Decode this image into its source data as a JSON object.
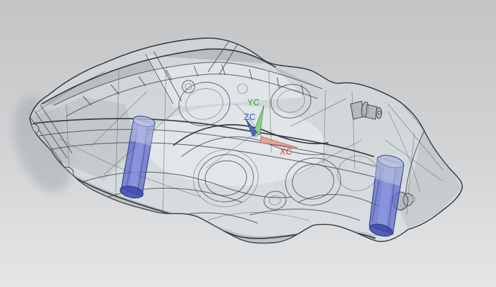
{
  "theme": {
    "bg-top": "#c2c4c6",
    "bg-mid": "#d2d4d6",
    "bg-bottom": "#e4e6e8",
    "edge": "#41464b",
    "edge-strong": "#2c3135",
    "edge-soft": "#5d6368",
    "body-fill": "#d5dde0",
    "body-dark": "#97a1a4",
    "body-light": "#eff4f5",
    "metal": "#aab2b8",
    "piston-fill": "#5a67cb",
    "piston-edge": "#2b3782",
    "piston-top": "#aeb6dd",
    "piston-bottom": "#3c49ae",
    "piston-highlight": "#93a0e8"
  },
  "scene": {
    "description": "Translucent wireframe 3D CAD model of a racing brake caliper, shaded-with-edges display style",
    "model": {
      "name": "brake-caliper",
      "parts": [
        {
          "name": "caliper-body"
        },
        {
          "name": "piston-left",
          "color": "#5a67cb"
        },
        {
          "name": "piston-right",
          "color": "#5a67cb"
        },
        {
          "name": "bleeder-fitting"
        },
        {
          "name": "mounting-lugs"
        },
        {
          "name": "retainer-bolt"
        }
      ]
    },
    "triad": {
      "name": "work-coordinate-system",
      "axes": [
        {
          "id": "xc",
          "label": "XC",
          "label_color": "#bf4636",
          "arrow_color": "#e7a198",
          "line_color": "#c05a4e"
        },
        {
          "id": "yc",
          "label": "YC",
          "label_color": "#2aa02a",
          "arrow_color": "#8ad08a",
          "line_color": "#3f9f3f"
        },
        {
          "id": "zc",
          "label": "ZC",
          "label_color": "#2b59d6",
          "arrow_color": "#5068c8",
          "line_color": "#3050b0"
        }
      ]
    }
  }
}
